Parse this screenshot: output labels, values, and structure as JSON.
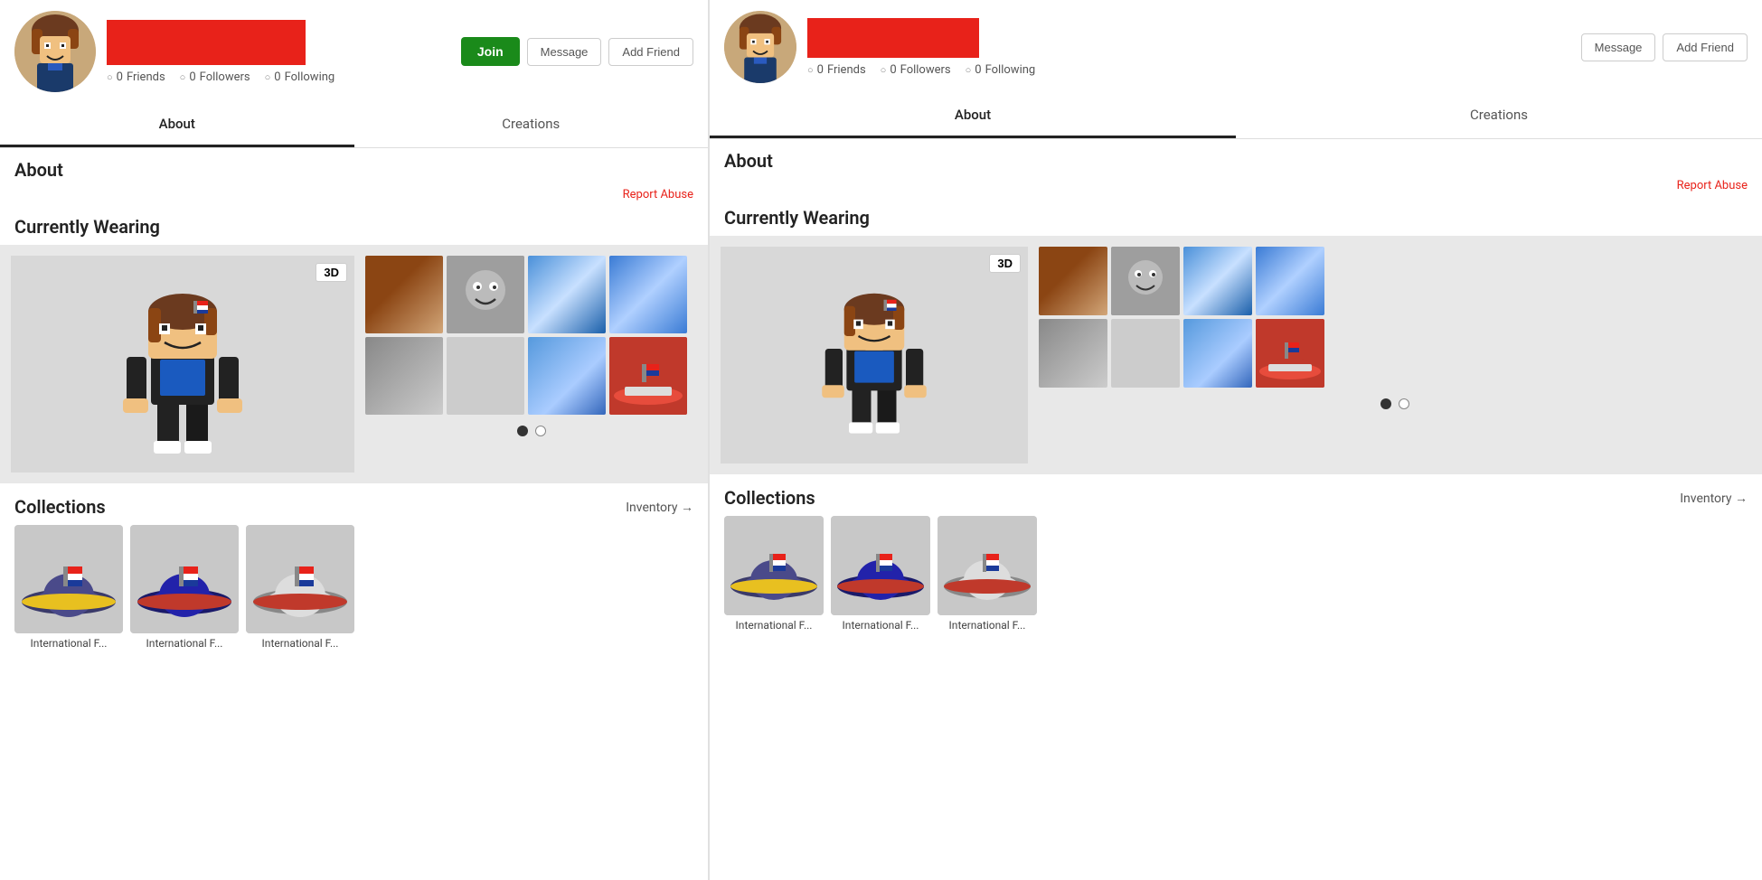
{
  "panels": [
    {
      "id": "left",
      "header": {
        "friends_count": "0",
        "followers_count": "0",
        "following_count": "0",
        "friends_label": "Friends",
        "followers_label": "Followers",
        "following_label": "Following",
        "join_label": "Join",
        "message_label": "Message",
        "add_friend_label": "Add Friend"
      },
      "tabs": [
        {
          "label": "About",
          "active": true
        },
        {
          "label": "Creations",
          "active": false
        }
      ],
      "about_label": "About",
      "report_abuse_label": "Report Abuse",
      "currently_wearing_label": "Currently Wearing",
      "collections_label": "Collections",
      "inventory_label": "Inventory →"
    },
    {
      "id": "right",
      "header": {
        "friends_count": "0",
        "followers_count": "0",
        "following_count": "0",
        "friends_label": "Friends",
        "followers_label": "Followers",
        "following_label": "Following",
        "message_label": "Message",
        "add_friend_label": "Add Friend"
      },
      "tabs": [
        {
          "label": "About",
          "active": true
        },
        {
          "label": "Creations",
          "active": false
        }
      ],
      "about_label": "About",
      "report_abuse_label": "Report Abuse",
      "currently_wearing_label": "Currently Wearing",
      "collections_label": "Collections",
      "inventory_label": "Inventory →"
    }
  ],
  "collection_items": [
    {
      "name": "International F..."
    },
    {
      "name": "International F..."
    },
    {
      "name": "International F..."
    }
  ],
  "colors": {
    "join_bg": "#1a8a1a",
    "report_abuse": "#e8221a",
    "banner_bg": "#e8221a"
  }
}
